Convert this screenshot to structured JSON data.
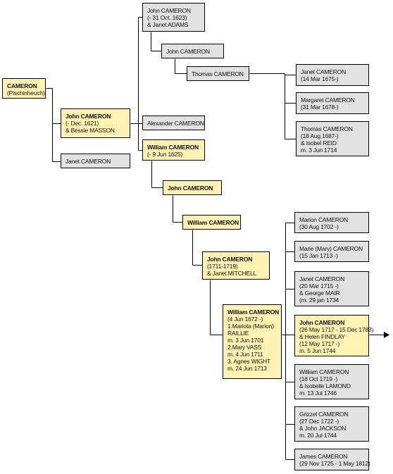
{
  "legend_colors": {
    "direct_line": "#fff2b3",
    "other_relative": "#e1e1e1",
    "connector": "#000000"
  },
  "people": {
    "p_root": {
      "lines": [
        "CAMERON",
        "(Pischinheuch)"
      ],
      "kind": "direct"
    },
    "p_john1621": {
      "lines": [
        "John CAMERON",
        "(- Dec. 1621)",
        "& Bessie MASSON"
      ],
      "kind": "direct"
    },
    "p_janet_a": {
      "lines": [
        "Janet CAMERON"
      ],
      "kind": "other"
    },
    "p_john1623": {
      "lines": [
        "John CAMERON",
        "(- 31 Oct. 1623)",
        "& Janet ADAMS"
      ],
      "kind": "other"
    },
    "p_john_b": {
      "lines": [
        "John CAMERON"
      ],
      "kind": "other"
    },
    "p_thomas_a": {
      "lines": [
        "Thomas CAMERON"
      ],
      "kind": "other"
    },
    "p_alexander": {
      "lines": [
        "Alexander CAMERON"
      ],
      "kind": "other"
    },
    "p_william1625": {
      "lines": [
        "William CAMERON",
        "(- 9 Jun 1625)"
      ],
      "kind": "direct"
    },
    "p_janet1675": {
      "lines": [
        "Janet CAMERON",
        "(14 Mar 1675-)"
      ],
      "kind": "other"
    },
    "p_margaret": {
      "lines": [
        "Margaret CAMERON",
        "(31 Mar 1678-)"
      ],
      "kind": "other"
    },
    "p_thomas1687": {
      "lines": [
        "Thomas CAMERON",
        "(18 Aug 1687-)",
        "& Isobel REID",
        "m. 3 Jun 1714"
      ],
      "kind": "other"
    },
    "p_john_c": {
      "lines": [
        "John CAMERON"
      ],
      "kind": "direct"
    },
    "p_william_b": {
      "lines": [
        "William CAMERON"
      ],
      "kind": "direct"
    },
    "p_john1711": {
      "lines": [
        "John CAMERON",
        "(1711-1719)",
        "& Janet MITCHELL"
      ],
      "kind": "direct"
    },
    "p_william1672": {
      "lines": [
        "William CAMERON",
        "(4 Jun 1672 -)",
        "1.Mariota (Marion)",
        "RAILLIE",
        "m. 3 Jun 1701",
        "2.Mary VASS",
        "m. 4 Jun 1711",
        "3. Agnes WIGHT",
        "m. 24 Jun 1713"
      ],
      "kind": "direct"
    },
    "p_marion": {
      "lines": [
        "Marion CAMERON",
        "(30 Aug 1702 -)"
      ],
      "kind": "other"
    },
    "p_marie": {
      "lines": [
        "Marie (Mary) CAMERON",
        "(15 Jan 1713 -)"
      ],
      "kind": "other"
    },
    "p_janet1715": {
      "lines": [
        "Janet CAMERON",
        "(20 Mar 1715 -)",
        "& George MAIR",
        "(m. 29 jan 1734"
      ],
      "kind": "other"
    },
    "p_john1717": {
      "lines": [
        "John CAMERON",
        "(26 May 1717 - 15 Dec 1783)",
        "& Helen FINDLAY",
        "(12 May 1717 -)",
        "m. 5 Jun 1744"
      ],
      "kind": "direct"
    },
    "p_william1719": {
      "lines": [
        "William CAMERON",
        "(18 Oct 1719 -)",
        "& Isobelle LAMOND",
        "m. 13 Jul 1746"
      ],
      "kind": "other"
    },
    "p_grizzel": {
      "lines": [
        "Grizzel CAMERON",
        "(27 Dec 1722 -)",
        "& John JACKSON",
        "m. 20 Jul 1744"
      ],
      "kind": "other"
    },
    "p_james": {
      "lines": [
        "James CAMERON",
        "(29 Nov 1725 - 1 May 1812)"
      ],
      "kind": "other"
    }
  },
  "continuation_arrow": {
    "from": "p_john1717",
    "icon": "arrow-right-icon"
  }
}
